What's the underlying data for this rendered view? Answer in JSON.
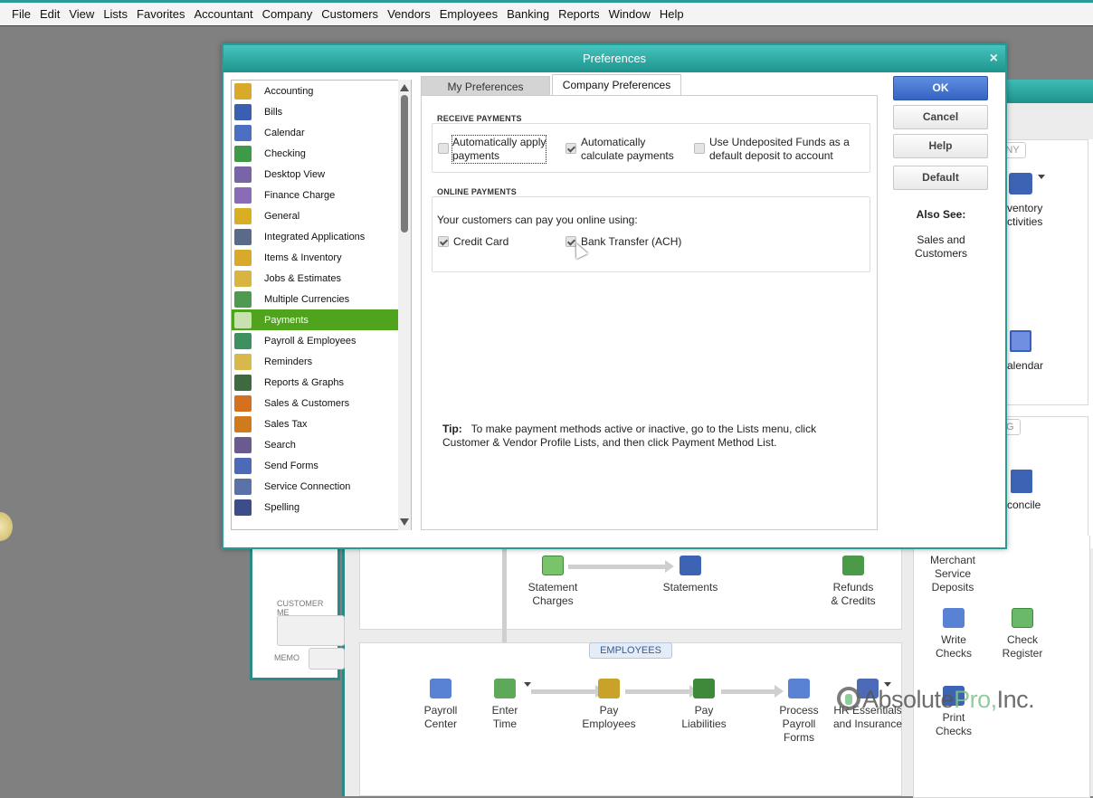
{
  "menubar": [
    "File",
    "Edit",
    "View",
    "Lists",
    "Favorites",
    "Accountant",
    "Company",
    "Customers",
    "Vendors",
    "Employees",
    "Banking",
    "Reports",
    "Window",
    "Help"
  ],
  "background": {
    "customer_memo_label": "CUSTOMER ME",
    "memo_label": "MEMO",
    "company_pill": "ANY",
    "banking_pill": "NG",
    "employees_pill": "EMPLOYEES",
    "right_items": {
      "inventory": "ventory\nctivities",
      "calendar": "alendar",
      "reconcile": "concile",
      "merchant": "Merchant\nService\nDeposits",
      "write_checks": "Write\nChecks",
      "check_register": "Check\nRegister",
      "print_checks": "Print\nChecks"
    },
    "customer_flow": {
      "statement_charges": "Statement\nCharges",
      "statements": "Statements",
      "refunds": "Refunds\n& Credits"
    },
    "employee_flow": {
      "payroll_center": "Payroll\nCenter",
      "enter_time": "Enter\nTime",
      "pay_employees": "Pay\nEmployees",
      "pay_liabilities": "Pay\nLiabilities",
      "process_forms": "Process\nPayroll\nForms",
      "hr_essentials": "HR Essentials\nand Insurance"
    }
  },
  "watermark": {
    "prefix": "Absolute",
    "pro": "Pro,",
    "suffix": "Inc."
  },
  "dialog": {
    "title": "Preferences",
    "close": "×",
    "categories": [
      {
        "label": "Accounting",
        "color": "#d9a92a"
      },
      {
        "label": "Bills",
        "color": "#3b5fb0"
      },
      {
        "label": "Calendar",
        "color": "#4c6fc4"
      },
      {
        "label": "Checking",
        "color": "#3e9a47"
      },
      {
        "label": "Desktop View",
        "color": "#7a64a8"
      },
      {
        "label": "Finance Charge",
        "color": "#8a6bb8"
      },
      {
        "label": "General",
        "color": "#d9ae22"
      },
      {
        "label": "Integrated Applications",
        "color": "#5c6a8a"
      },
      {
        "label": "Items & Inventory",
        "color": "#d9a92a"
      },
      {
        "label": "Jobs & Estimates",
        "color": "#d9b440"
      },
      {
        "label": "Multiple Currencies",
        "color": "#4f9a50"
      },
      {
        "label": "Payments",
        "color": "#c9e0b0",
        "selected": true
      },
      {
        "label": "Payroll & Employees",
        "color": "#3f9060"
      },
      {
        "label": "Reminders",
        "color": "#d7b84a"
      },
      {
        "label": "Reports & Graphs",
        "color": "#3f6a3f"
      },
      {
        "label": "Sales & Customers",
        "color": "#d4701e"
      },
      {
        "label": "Sales Tax",
        "color": "#d07a1e"
      },
      {
        "label": "Search",
        "color": "#6a5a90"
      },
      {
        "label": "Send Forms",
        "color": "#4d6ab8"
      },
      {
        "label": "Service Connection",
        "color": "#5a72a8"
      },
      {
        "label": "Spelling",
        "color": "#3c4d8a"
      }
    ],
    "tabs": {
      "my": "My Preferences",
      "company": "Company Preferences",
      "active": "company"
    },
    "receive_payments": {
      "heading": "RECEIVE PAYMENTS",
      "auto_apply": {
        "label": "Automatically apply\npayments",
        "checked": false
      },
      "auto_calc": {
        "label": "Automatically\ncalculate payments",
        "checked": true
      },
      "undeposited": {
        "label": "Use Undeposited Funds as a\ndefault deposit to account",
        "checked": false
      }
    },
    "online_payments": {
      "heading": "ONLINE PAYMENTS",
      "intro": "Your customers can pay you online using:",
      "credit_card": {
        "label": "Credit Card",
        "checked": true
      },
      "bank_transfer": {
        "label": "Bank Transfer (ACH)",
        "checked": true
      }
    },
    "tip": {
      "label": "Tip:",
      "text": "To make payment methods active or inactive, go to the Lists menu, click Customer & Vendor Profile Lists, and then click Payment Method List."
    },
    "buttons": {
      "ok": "OK",
      "cancel": "Cancel",
      "help": "Help",
      "default": "Default"
    },
    "also_see": {
      "heading": "Also See:",
      "link": "Sales and\nCustomers"
    }
  }
}
